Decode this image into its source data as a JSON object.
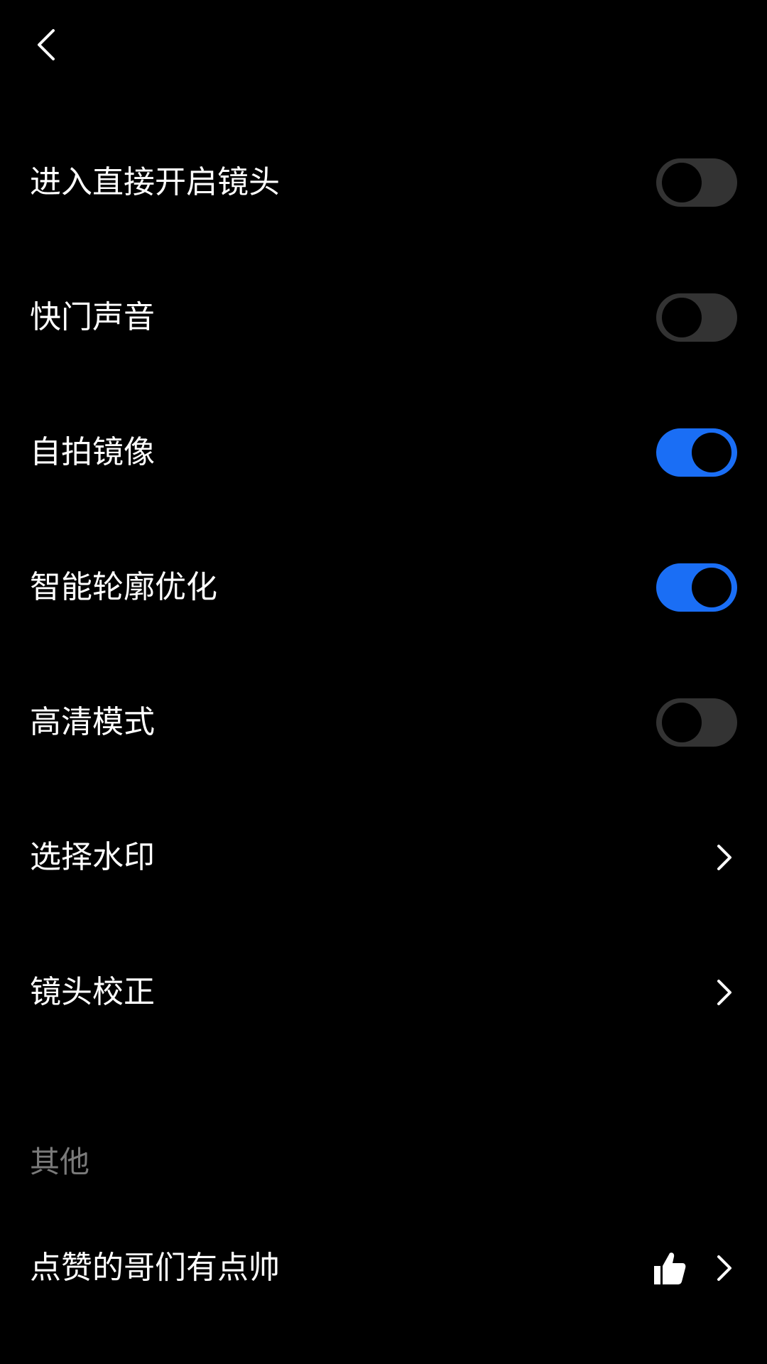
{
  "colors": {
    "background": "#000000",
    "text": "#ffffff",
    "section_text": "#7a7a7a",
    "toggle_on": "#1a6ef5",
    "toggle_off": "#333333"
  },
  "header": {
    "back_icon": "chevron-left-icon"
  },
  "settings": [
    {
      "label": "进入直接开启镜头",
      "control": "toggle",
      "checked": false
    },
    {
      "label": "快门声音",
      "control": "toggle",
      "checked": false
    },
    {
      "label": "自拍镜像",
      "control": "toggle",
      "checked": true
    },
    {
      "label": "智能轮廓优化",
      "control": "toggle",
      "checked": true
    },
    {
      "label": "高清模式",
      "control": "toggle",
      "checked": false
    },
    {
      "label": "选择水印",
      "control": "chevron",
      "icon": "chevron-right-icon"
    },
    {
      "label": "镜头校正",
      "control": "chevron",
      "icon": "chevron-right-icon"
    }
  ],
  "other_section": {
    "title": "其他",
    "items": [
      {
        "label": "点赞的哥们有点帅",
        "icon": "thumbs-up-icon",
        "chevron_icon": "chevron-right-icon"
      }
    ]
  }
}
